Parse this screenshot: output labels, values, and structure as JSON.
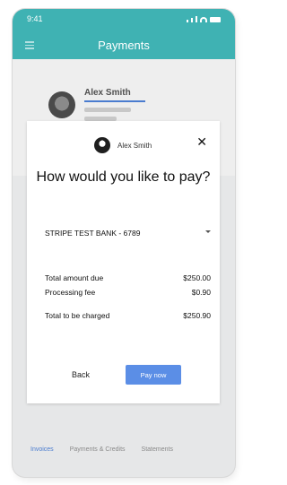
{
  "status_bar": {
    "time": "9:41"
  },
  "header": {
    "title": "Payments"
  },
  "background": {
    "account_name": "Alex Smith"
  },
  "bottom_tabs": [
    "Invoices",
    "Payments & Credits",
    "Statements"
  ],
  "modal": {
    "user_name": "Alex Smith",
    "title": "How would you like to pay?",
    "payment_method": "STRIPE TEST BANK - 6789",
    "summary": [
      {
        "label": "Total amount due",
        "amount": "$250.00"
      },
      {
        "label": "Processing fee",
        "amount": "$0.90"
      },
      {
        "label": "Total to be charged",
        "amount": "$250.90"
      }
    ],
    "back_label": "Back",
    "pay_label": "Pay now"
  }
}
